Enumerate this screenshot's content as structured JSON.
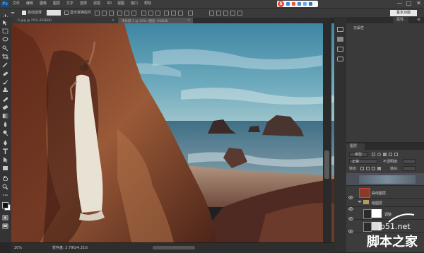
{
  "app": {
    "logo": "Ps",
    "menu": [
      "文件",
      "编辑",
      "图像",
      "图层",
      "文字",
      "选择",
      "滤镜",
      "3D",
      "视图",
      "窗口",
      "帮助"
    ],
    "window_controls": [
      "—",
      "□",
      "✕"
    ]
  },
  "options": {
    "auto_select_label": "自动选择",
    "transform_label": "显示变换控件",
    "workspace": "基本功能"
  },
  "tabs": [
    {
      "label": "...5.jpg @ 25% (RGB/8)",
      "close": "×"
    },
    {
      "label": "未标题-1 @ 20% (图层, RGB/8)",
      "close": "×"
    }
  ],
  "status": {
    "zoom": "20%",
    "doc": "暂存盘: 2.79G/4.21G"
  },
  "properties_panel": {
    "tabs": [
      "",
      "",
      "属性",
      ""
    ],
    "content_label": "无属性"
  },
  "layers_panel": {
    "tabs": [
      "图层",
      "",
      ""
    ],
    "kind_label": "类型",
    "blend_mode": "正常",
    "opacity_label": "不透明度:",
    "lock_label": "锁定:",
    "fill_label": "填充:",
    "layers": [
      {
        "name": ""
      },
      {
        "name": "曲线图层"
      },
      {
        "name": "组图层"
      },
      {
        "name": "调整"
      },
      {
        "name": ""
      }
    ]
  },
  "watermark": {
    "site": "jb51.net",
    "cn": "脚本之家"
  },
  "colors": {
    "accent": "#31a8ff",
    "sky": "#4f8fa5",
    "rock": "#8a4a2e"
  }
}
